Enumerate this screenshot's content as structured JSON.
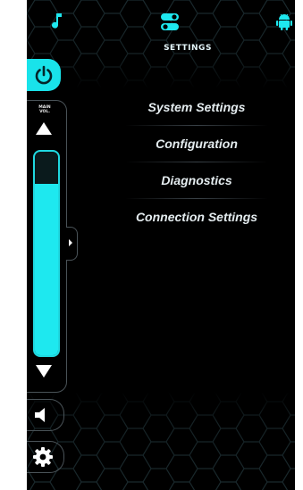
{
  "header": {
    "title": "SETTINGS",
    "icons": [
      "music-note-icon",
      "settings-toggle-icon",
      "android-icon"
    ]
  },
  "rail": {
    "power_icon": "power-icon",
    "volume_label_line1": "MAIN",
    "volume_label_line2": "VOL.",
    "volume_level": 0.84,
    "volume_up_icon": "triangle-up-icon",
    "volume_down_icon": "triangle-down-icon",
    "mute_icon": "speaker-mute-icon",
    "settings_icon": "gear-icon"
  },
  "menu": {
    "items": [
      {
        "label": "System Settings"
      },
      {
        "label": "Configuration"
      },
      {
        "label": "Diagnostics"
      },
      {
        "label": "Connection Settings"
      }
    ]
  },
  "colors": {
    "accent": "#1ee8ef",
    "background": "#000000",
    "frame": "#4a5358",
    "text": "#e4ecef"
  }
}
